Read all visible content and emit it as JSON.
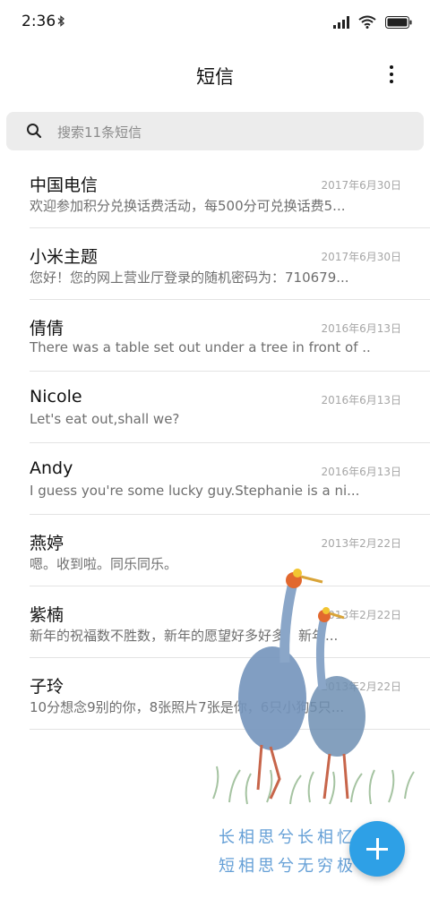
{
  "status_bar": {
    "time": "2:36",
    "bluetooth_icon": "bluetooth-icon",
    "signal_icon": "signal-icon",
    "wifi_icon": "wifi-icon",
    "battery_icon": "battery-icon"
  },
  "app_bar": {
    "title": "短信",
    "more_icon": "more-vertical-icon"
  },
  "search": {
    "placeholder": "搜索11条短信",
    "icon": "search-icon"
  },
  "conversations": [
    {
      "name": "中国电信",
      "date": "2017年6月30日",
      "preview": "欢迎参加积分兑换话费活动，每500分可兑换话费5..."
    },
    {
      "name": "小米主题",
      "date": "2017年6月30日",
      "preview": "您好！您的网上营业厅登录的随机密码为：710679..."
    },
    {
      "name": "倩倩",
      "date": "2016年6月13日",
      "preview": "There was a table set out under a tree in front of ..."
    },
    {
      "name": "Nicole",
      "date": "2016年6月13日",
      "preview": "Let's eat out,shall we?"
    },
    {
      "name": "Andy",
      "date": "2016年6月13日",
      "preview": "I guess you're some lucky guy.Stephanie is a ni..."
    },
    {
      "name": "燕婷",
      "date": "2013年2月22日",
      "preview": "嗯。收到啦。同乐同乐。"
    },
    {
      "name": "紫楠",
      "date": "2013年2月22日",
      "preview": "新年的祝福数不胜数，新年的愿望好多好多，新年..."
    },
    {
      "name": "子玲",
      "date": "2013年2月22日",
      "preview": "10分想念9别的你，8张照片7张是你，6只小狗5只..."
    }
  ],
  "wallpaper": {
    "poem_line1": "长相思兮长相忆",
    "poem_line2": "短相思兮无穷极",
    "accent_color": "#4a8fd0"
  },
  "fab": {
    "icon": "plus-icon",
    "color": "#2ea0e6"
  }
}
